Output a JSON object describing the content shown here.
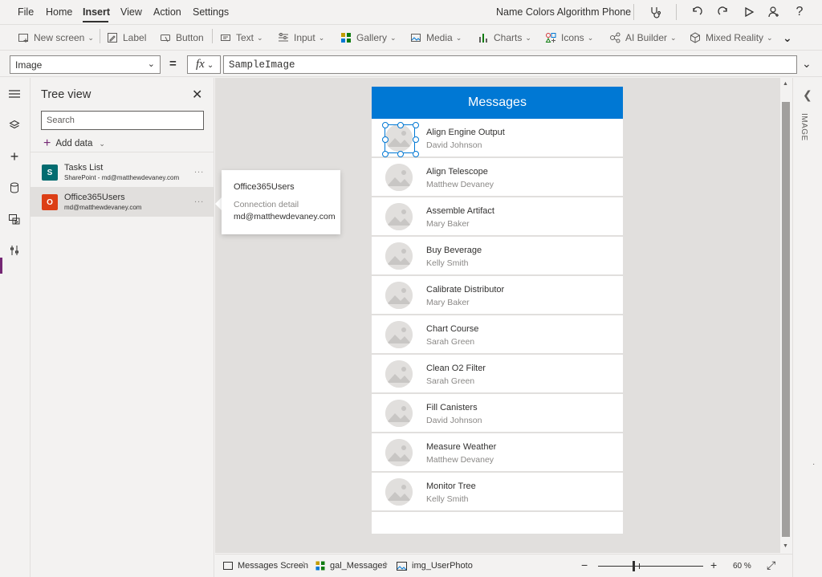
{
  "menu": {
    "items": [
      "File",
      "Home",
      "Insert",
      "View",
      "Action",
      "Settings"
    ],
    "active": "Insert",
    "app_title": "Name Colors Algorithm Phone"
  },
  "ribbon": {
    "new_screen": "New screen",
    "label": "Label",
    "button": "Button",
    "text": "Text",
    "input": "Input",
    "gallery": "Gallery",
    "media": "Media",
    "charts": "Charts",
    "icons": "Icons",
    "ai_builder": "AI Builder",
    "mixed_reality": "Mixed Reality"
  },
  "formula": {
    "property": "Image",
    "equals": "=",
    "fx": "fx",
    "value": "SampleImage"
  },
  "tree": {
    "title": "Tree view",
    "search_placeholder": "Search",
    "add_data": "Add data",
    "sources": [
      {
        "name": "Tasks List",
        "detail": "SharePoint - md@matthewdevaney.com",
        "logo_color": "#036c70",
        "more": "..."
      },
      {
        "name": "Office365Users",
        "detail": "md@matthewdevaney.com",
        "logo_color": "#dc3e15",
        "more": "..."
      }
    ]
  },
  "tooltip": {
    "title": "Office365Users",
    "label": "Connection detail",
    "value": "md@matthewdevaney.com"
  },
  "screen": {
    "header": "Messages",
    "header_color": "#0078d4",
    "items": [
      {
        "title": "Align Engine Output",
        "subtitle": "David Johnson"
      },
      {
        "title": "Align Telescope",
        "subtitle": "Matthew Devaney"
      },
      {
        "title": "Assemble Artifact",
        "subtitle": "Mary Baker"
      },
      {
        "title": "Buy Beverage",
        "subtitle": "Kelly Smith"
      },
      {
        "title": "Calibrate Distributor",
        "subtitle": "Mary Baker"
      },
      {
        "title": "Chart Course",
        "subtitle": "Sarah Green"
      },
      {
        "title": "Clean O2 Filter",
        "subtitle": "Sarah Green"
      },
      {
        "title": "Fill Canisters",
        "subtitle": "David Johnson"
      },
      {
        "title": "Measure Weather",
        "subtitle": "Matthew Devaney"
      },
      {
        "title": "Monitor Tree",
        "subtitle": "Kelly Smith"
      }
    ]
  },
  "right_panel": {
    "label": "IMAGE"
  },
  "bottom": {
    "crumbs": [
      "Messages Screen",
      "gal_Messages",
      "img_UserPhoto"
    ],
    "zoom": "60 %",
    "zoom_minus": "−",
    "zoom_plus": "+"
  },
  "accent": "#742774"
}
